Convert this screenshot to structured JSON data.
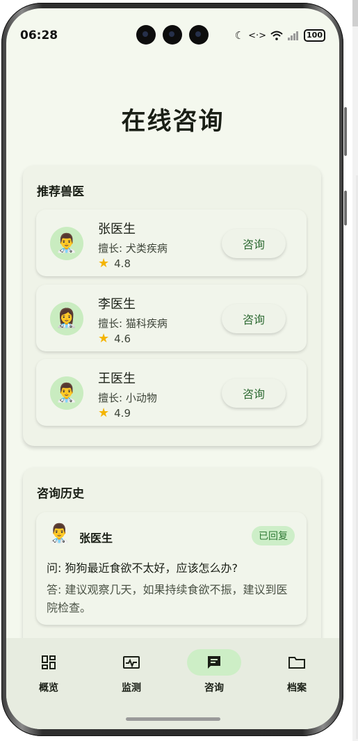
{
  "status_bar": {
    "time": "06:28",
    "battery": "100",
    "icons": [
      "moon-icon",
      "data-sync-icon",
      "wifi-icon",
      "signal-icon",
      "battery-icon"
    ]
  },
  "page": {
    "title": "在线咨询"
  },
  "recommended": {
    "title": "推荐兽医",
    "vets": [
      {
        "avatar": "👨‍⚕️",
        "name": "张医生",
        "specialty": "擅长: 犬类疾病",
        "rating": "4.8",
        "button": "咨询"
      },
      {
        "avatar": "👩‍⚕️",
        "name": "李医生",
        "specialty": "擅长: 猫科疾病",
        "rating": "4.6",
        "button": "咨询"
      },
      {
        "avatar": "👨‍⚕️",
        "name": "王医生",
        "specialty": "擅长: 小动物",
        "rating": "4.9",
        "button": "咨询"
      }
    ]
  },
  "history": {
    "title": "咨询历史",
    "items": [
      {
        "avatar": "👨‍⚕️",
        "doctor": "张医生",
        "status": "已回复",
        "question": "问: 狗狗最近食欲不太好，应该怎么办?",
        "answer": "答: 建议观察几天，如果持续食欲不振，建议到医院检查。"
      }
    ]
  },
  "nav": {
    "items": [
      {
        "label": "概览",
        "icon": "grid-icon"
      },
      {
        "label": "监测",
        "icon": "monitor-icon"
      },
      {
        "label": "咨询",
        "icon": "chat-icon",
        "active": true
      },
      {
        "label": "档案",
        "icon": "folder-icon"
      }
    ]
  },
  "colors": {
    "background": "#f4f8ee",
    "accent": "#2f6b34",
    "active_pill": "#cdeec6",
    "star": "#f4b400"
  }
}
